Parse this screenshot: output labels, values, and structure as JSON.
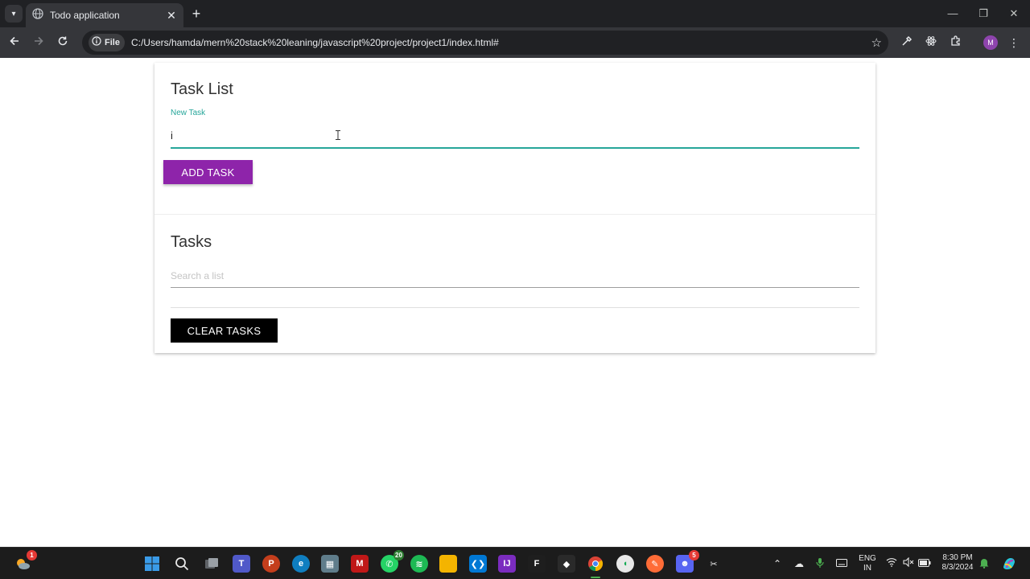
{
  "browser": {
    "tab_title": "Todo application",
    "tab_close": "✕",
    "new_tab": "+",
    "chip_label": "File",
    "url": "C:/Users/hamda/mern%20stack%20leaning/javascript%20project/project1/index.html#",
    "profile_initial": "M",
    "window_controls": {
      "minimize": "—",
      "restore": "❐",
      "close": "✕"
    }
  },
  "task_list": {
    "title": "Task List",
    "input_label": "New Task",
    "input_value": "i",
    "add_button": "ADD TASK"
  },
  "tasks": {
    "title": "Tasks",
    "search_placeholder": "Search a list",
    "clear_button": "CLEAR TASKS"
  },
  "taskbar": {
    "apps": [
      {
        "name": "windows-start-icon",
        "badge": ""
      },
      {
        "name": "search-icon",
        "badge": ""
      },
      {
        "name": "task-view-icon",
        "badge": ""
      },
      {
        "name": "teams-icon",
        "badge": ""
      },
      {
        "name": "powerpoint-icon",
        "badge": ""
      },
      {
        "name": "edge-icon",
        "badge": ""
      },
      {
        "name": "store-icon",
        "badge": ""
      },
      {
        "name": "mcafee-icon",
        "badge": ""
      },
      {
        "name": "whatsapp-icon",
        "badge": "20"
      },
      {
        "name": "spotify-icon",
        "badge": ""
      },
      {
        "name": "file-explorer-icon",
        "badge": ""
      },
      {
        "name": "vscode-icon",
        "badge": ""
      },
      {
        "name": "intellij-icon",
        "badge": ""
      },
      {
        "name": "figma-icon",
        "badge": ""
      },
      {
        "name": "davinci-icon",
        "badge": ""
      },
      {
        "name": "chrome-icon",
        "badge": ""
      },
      {
        "name": "mongodb-icon",
        "badge": ""
      },
      {
        "name": "postman-icon",
        "badge": ""
      },
      {
        "name": "discord-icon",
        "badge": "5"
      },
      {
        "name": "snipping-tool-icon",
        "badge": ""
      }
    ],
    "weather_badge": "1",
    "language": "ENG",
    "region": "IN",
    "time": "8:30 PM",
    "date": "8/3/2024"
  },
  "colors": {
    "accent_teal": "#26a69a",
    "add_button_purple": "#8e24aa",
    "clear_button_black": "#000000",
    "chrome_dark": "#202124",
    "chrome_toolbar": "#35363a"
  }
}
